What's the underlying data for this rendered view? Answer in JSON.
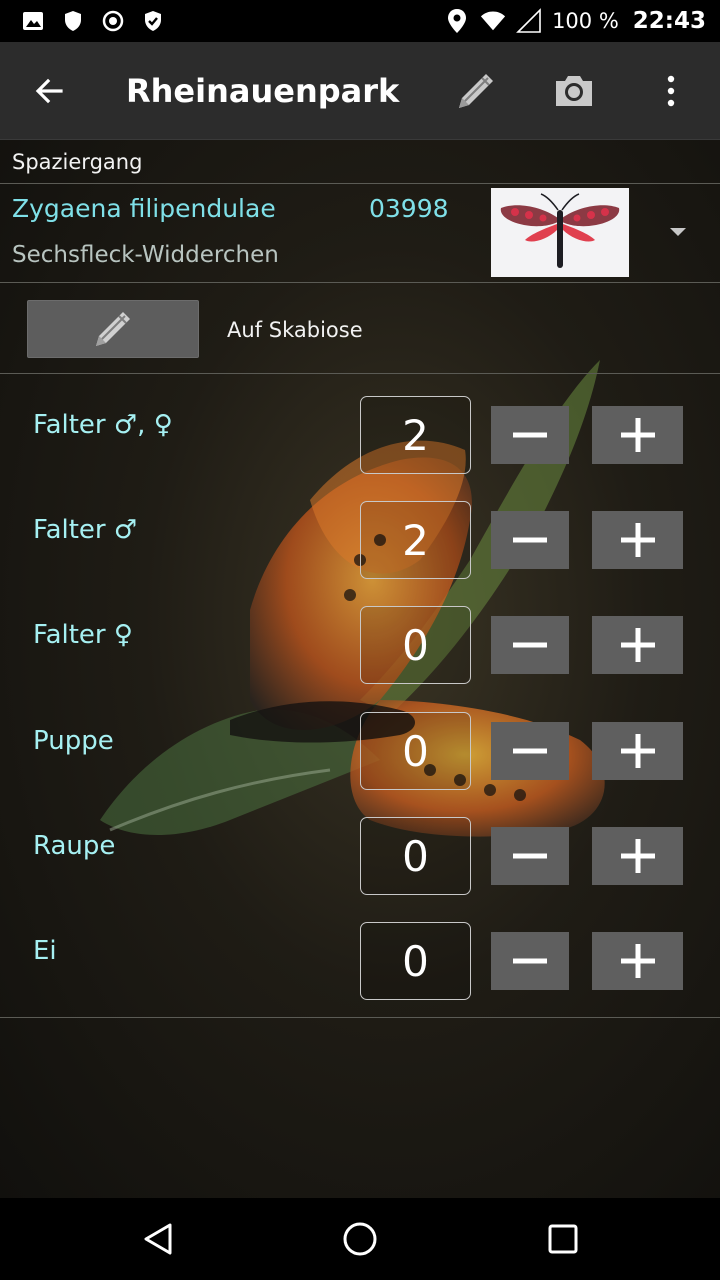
{
  "status_bar": {
    "left_icons": [
      "image-icon",
      "shield-icon",
      "record-icon",
      "check-shield-icon"
    ],
    "right_icons": [
      "location-icon",
      "wifi-icon",
      "signal-icon"
    ],
    "battery_percent": "100 %",
    "time": "22:43"
  },
  "toolbar": {
    "title": "Rheinauenpark",
    "icons": [
      "back-arrow-icon",
      "pencil-icon",
      "camera-icon",
      "overflow-menu-icon"
    ]
  },
  "section": {
    "label": "Spaziergang"
  },
  "species": {
    "latin_name": "Zygaena filipendulae",
    "code": "03998",
    "german_name": "Sechsfleck-Widderchen",
    "thumbnail_icon": "moth-photo",
    "dropdown_icon": "triangle-down-icon"
  },
  "note": {
    "text": "Auf Skabiose",
    "button_icon": "pencil-icon"
  },
  "counts": [
    {
      "label": "Falter ♂, ♀",
      "value": "2"
    },
    {
      "label": "Falter ♂",
      "value": "2"
    },
    {
      "label": "Falter ♀",
      "value": "0"
    },
    {
      "label": "Puppe",
      "value": "0"
    },
    {
      "label": "Raupe",
      "value": "0"
    },
    {
      "label": "Ei",
      "value": "0"
    }
  ],
  "nav_bar": {
    "icons": [
      "back-triangle-icon",
      "home-circle-icon",
      "recents-square-icon"
    ]
  },
  "colors": {
    "accent_text": "#7fe0e8",
    "label_text": "#a6f0f2",
    "toolbar_bg": "#2c2c2c",
    "button_bg": "#5f5f5f"
  }
}
